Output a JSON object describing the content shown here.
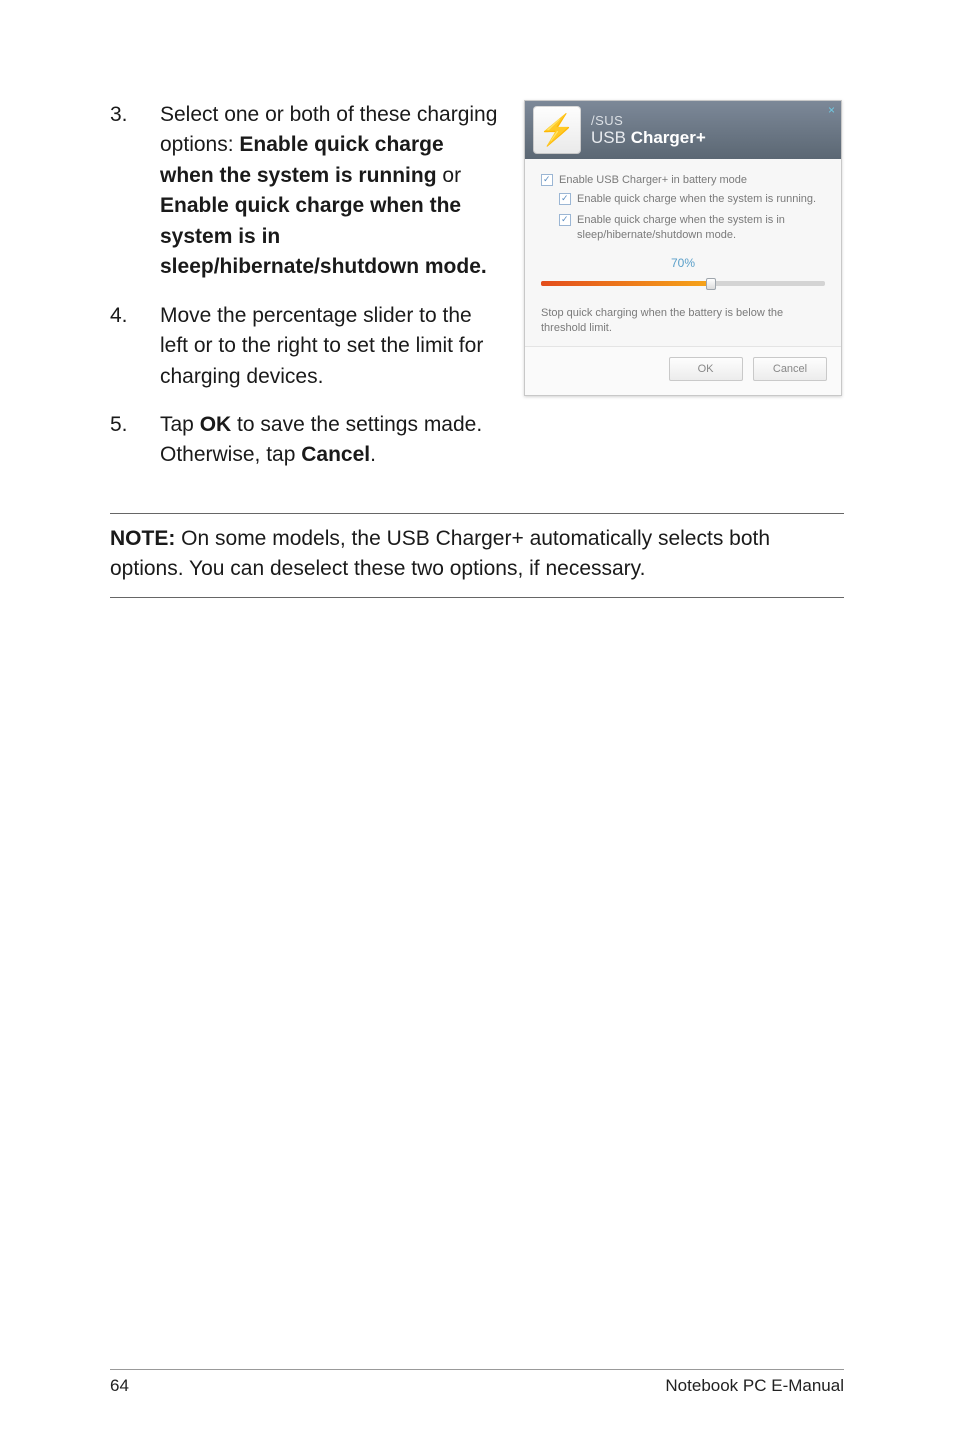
{
  "steps": [
    {
      "num": "3.",
      "parts": [
        {
          "t": "Select one or both of these charging options: ",
          "b": false
        },
        {
          "t": "Enable quick charge when the system is running",
          "b": true
        },
        {
          "t": " or ",
          "b": false
        },
        {
          "t": "Enable quick charge when the system is in sleep/hibernate/shutdown mode.",
          "b": true
        }
      ]
    },
    {
      "num": "4.",
      "parts": [
        {
          "t": "Move the percentage slider to the left or to the right to set the limit for charging devices.",
          "b": false
        }
      ]
    },
    {
      "num": "5.",
      "parts": [
        {
          "t": "Tap ",
          "b": false
        },
        {
          "t": "OK",
          "b": true
        },
        {
          "t": " to save the settings made. Otherwise, tap ",
          "b": false
        },
        {
          "t": "Cancel",
          "b": true
        },
        {
          "t": ".",
          "b": false
        }
      ]
    }
  ],
  "note": {
    "label": "NOTE:",
    "text": " On some models, the USB Charger+ automatically selects both options. You can deselect these two options, if necessary."
  },
  "dialog": {
    "brand": "/SUS",
    "product_prefix": "USB ",
    "product_bold": "Charger+",
    "close": "×",
    "bolt": "⚡",
    "main_check": "Enable USB Charger+ in battery mode",
    "sub_check1": "Enable quick charge when the system is running.",
    "sub_check2": "Enable quick charge when the system is in sleep/hibernate/shutdown mode.",
    "percent": "70%",
    "threshold": "Stop quick charging when the battery is below the threshold limit.",
    "ok": "OK",
    "cancel": "Cancel"
  },
  "footer": {
    "page": "64",
    "title": "Notebook PC E-Manual"
  }
}
